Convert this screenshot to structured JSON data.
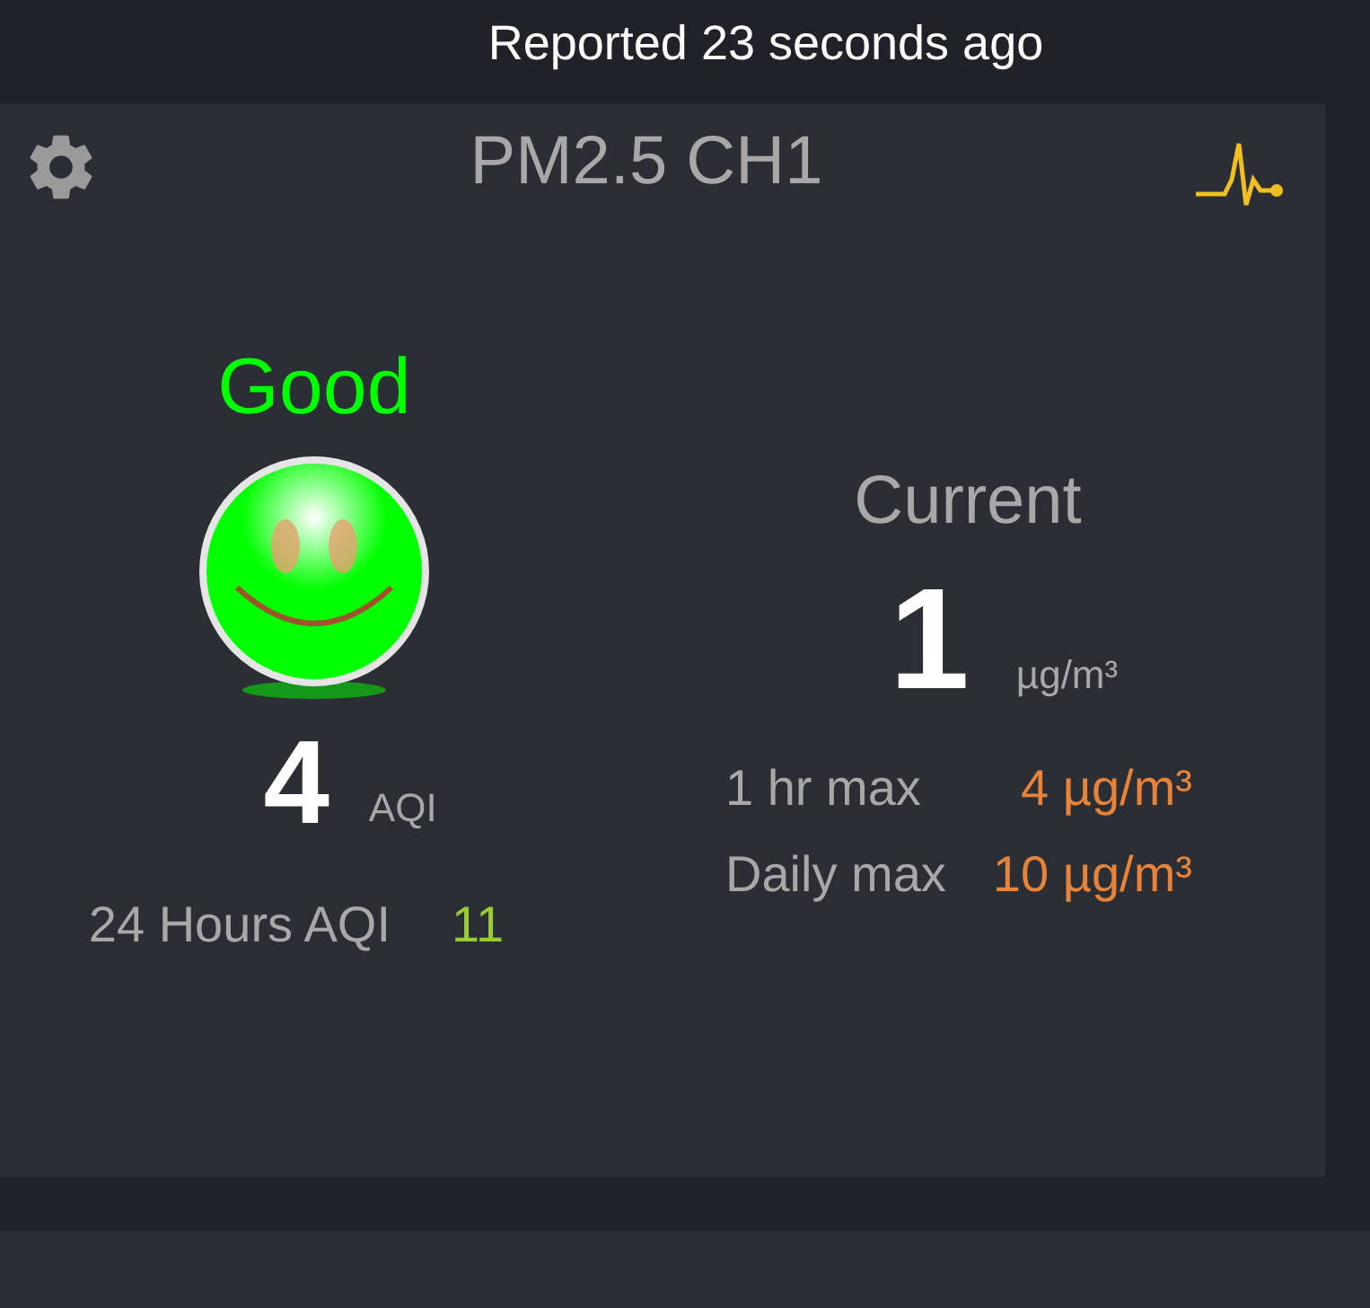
{
  "status_bar": {
    "text": "Reported 23 seconds ago"
  },
  "card": {
    "title": "PM2.5 CH1",
    "aqi": {
      "category": "Good",
      "kind": "good",
      "value": "4",
      "unit": "AQI",
      "daily_label": "24 Hours AQI",
      "daily_value": "11"
    },
    "current": {
      "label": "Current",
      "value": "1",
      "unit": "µg/m³",
      "stats": [
        {
          "label": "1 hr max",
          "value": "4 µg/m³"
        },
        {
          "label": "Daily max",
          "value": "10 µg/m³"
        }
      ]
    }
  }
}
